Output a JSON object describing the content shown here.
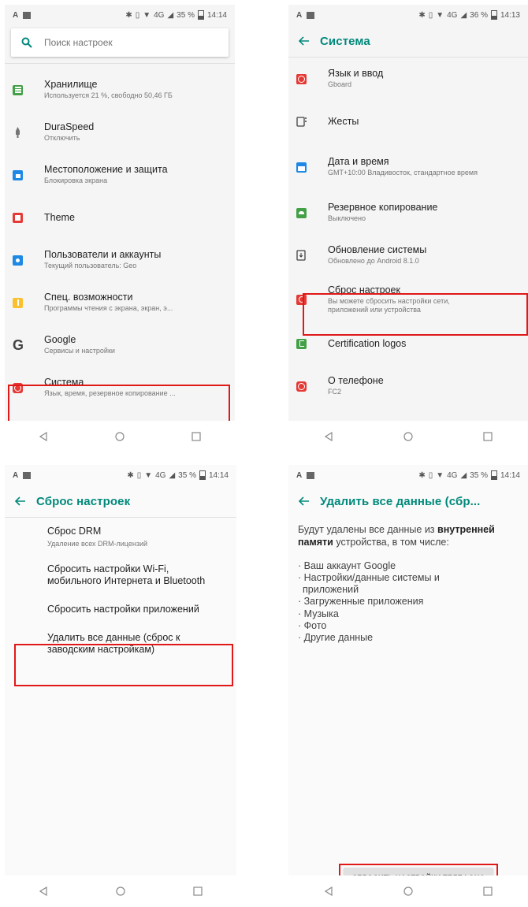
{
  "status": {
    "p1": {
      "battery": "35 %",
      "time": "14:14"
    },
    "p2": {
      "battery": "36 %",
      "time": "14:13"
    },
    "p3": {
      "battery": "35 %",
      "time": "14:14"
    },
    "p4": {
      "battery": "35 %",
      "time": "14:14"
    },
    "network": "4G"
  },
  "screen1": {
    "search_placeholder": "Поиск настроек",
    "items": [
      {
        "title": "Хранилище",
        "subtitle": "Используется 21 %, свободно 50,46 ГБ",
        "icon": "storage-icon",
        "color": "#43a047"
      },
      {
        "title": "DuraSpeed",
        "subtitle": "Отключить",
        "icon": "rocket-icon",
        "color": "#757575"
      },
      {
        "title": "Местоположение и защита",
        "subtitle": "Блокировка экрана",
        "icon": "lock-icon",
        "color": "#1e88e5"
      },
      {
        "title": "Theme",
        "subtitle": "",
        "icon": "theme-icon",
        "color": "#e53935"
      },
      {
        "title": "Пользователи и аккаунты",
        "subtitle": "Текущий пользователь: Geo",
        "icon": "user-icon",
        "color": "#1e88e5"
      },
      {
        "title": "Спец. возможности",
        "subtitle": "Программы чтения с экрана, экран, э...",
        "icon": "accessibility-icon",
        "color": "#fbc02d"
      },
      {
        "title": "Google",
        "subtitle": "Сервисы и настройки",
        "icon": "google-icon",
        "color": "#424242"
      },
      {
        "title": "Система",
        "subtitle": "Язык, время, резервное копирование ...",
        "icon": "info-icon",
        "color": "#e53935"
      }
    ]
  },
  "screen2": {
    "title": "Система",
    "items": [
      {
        "title": "Язык и ввод",
        "subtitle": "Gboard",
        "icon": "globe-icon",
        "color": "#e53935"
      },
      {
        "title": "Жесты",
        "subtitle": "",
        "icon": "gesture-icon",
        "color": "#424242"
      },
      {
        "title": "Дата и время",
        "subtitle": "GMT+10:00 Владивосток, стандартное время",
        "icon": "calendar-icon",
        "color": "#1e88e5"
      },
      {
        "title": "Резервное копирование",
        "subtitle": "Выключено",
        "icon": "backup-icon",
        "color": "#43a047"
      },
      {
        "title": "Обновление системы",
        "subtitle": "Обновлено до Android 8.1.0",
        "icon": "system-update-icon",
        "color": "#424242"
      },
      {
        "title": "Сброс настроек",
        "subtitle": "Вы можете сбросить настройки сети, приложений или устройства",
        "icon": "reset-icon",
        "color": "#e53935"
      },
      {
        "title": "Certification logos",
        "subtitle": "",
        "icon": "certification-icon",
        "color": "#43a047"
      },
      {
        "title": "О телефоне",
        "subtitle": "FC2",
        "icon": "phone-info-icon",
        "color": "#e53935"
      }
    ]
  },
  "screen3": {
    "title": "Сброс настроек",
    "items": [
      {
        "title": "Сброс DRM",
        "subtitle": "Удаление всех DRM-лицензий"
      },
      {
        "title": "Сбросить настройки Wi-Fi, мобильного Интернета и Bluetooth",
        "subtitle": ""
      },
      {
        "title": "Сбросить настройки приложений",
        "subtitle": ""
      },
      {
        "title": "Удалить все данные (сброс к заводским настройкам)",
        "subtitle": ""
      }
    ]
  },
  "screen4": {
    "title": "Удалить все данные (сбр...",
    "intro_before": "Будут удалены все данные из ",
    "intro_bold": "внутренней памяти",
    "intro_after": " устройства, в том числе:",
    "bullets": [
      "· Ваш аккаунт Google",
      "· Настройки/данные системы и приложений",
      "· Загруженные приложения",
      "· Музыка",
      "· Фото",
      "· Другие данные"
    ],
    "button_label": "СБРОСИТЬ НАСТРОЙКИ ТЕЛЕФОНА"
  },
  "colors": {
    "accent": "#00897b",
    "highlight": "#e01818"
  }
}
